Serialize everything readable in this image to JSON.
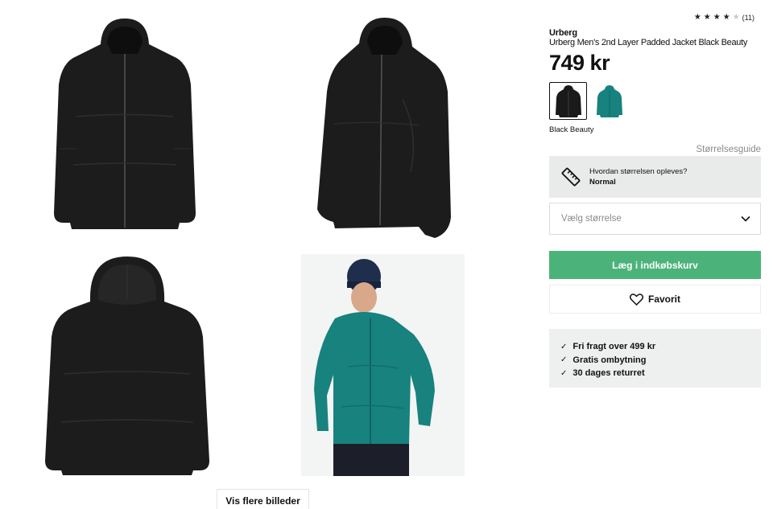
{
  "gallery": {
    "images": [
      {
        "icon": "jacket-front-icon",
        "color": "#1c1c1c"
      },
      {
        "icon": "jacket-side-icon",
        "color": "#1c1c1c"
      },
      {
        "icon": "jacket-back-icon",
        "color": "#1c1c1c"
      },
      {
        "icon": "model-wearing-jacket-icon",
        "color": "#17827e"
      }
    ],
    "more_label": "Vis flere billeder"
  },
  "product": {
    "rating": {
      "value": 3.5,
      "max": 5,
      "count_label": "(11)"
    },
    "brand": "Urberg",
    "name": "Urberg Men's 2nd Layer Padded Jacket Black Beauty",
    "price": "749 kr",
    "swatches": [
      {
        "color": "#1a1a1a",
        "selected": true
      },
      {
        "color": "#17827e",
        "selected": false
      }
    ],
    "selected_color_name": "Black Beauty",
    "size_guide_label": "Størrelsesguide",
    "fit": {
      "question": "Hvordan størrelsen opleves?",
      "answer": "Normal"
    },
    "size_select_placeholder": "Vælg størrelse",
    "add_to_cart_label": "Læg i indkøbskurv",
    "favorite_label": "Favorit",
    "usps": [
      "Fri fragt over 499 kr",
      "Gratis ombytning",
      "30 dages returret"
    ]
  },
  "colors": {
    "accent_green": "#4bb37a",
    "panel_grey": "#e9eaea",
    "muted_text": "#8a8a8a"
  }
}
